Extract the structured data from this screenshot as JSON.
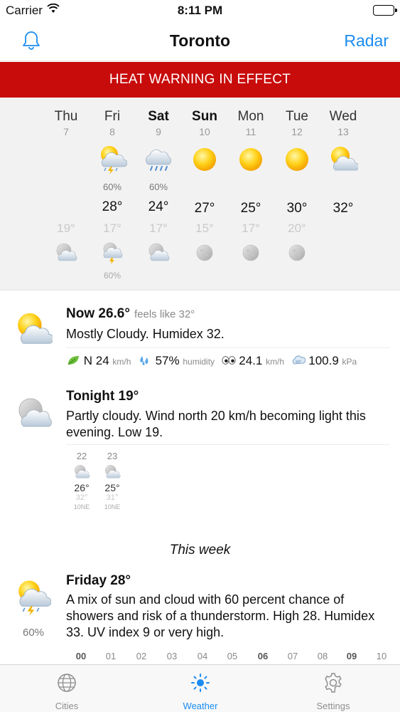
{
  "status_bar": {
    "carrier": "Carrier",
    "time": "8:11 PM"
  },
  "nav": {
    "title": "Toronto",
    "right_label": "Radar",
    "left_icon": "bell-icon"
  },
  "alert": {
    "text": "HEAT WARNING IN EFFECT",
    "color": "#c80b0b"
  },
  "forecast": [
    {
      "day": "Thu",
      "date": "7",
      "bold": false,
      "icon": "",
      "pop": "",
      "high": "",
      "low": "19°",
      "night_icon": "night-partly-cloudy-icon",
      "night_pop": ""
    },
    {
      "day": "Fri",
      "date": "8",
      "bold": false,
      "icon": "sun-cloud-thunder-icon",
      "pop": "60%",
      "high": "28°",
      "low": "17°",
      "night_icon": "night-thunder-icon",
      "night_pop": "60%"
    },
    {
      "day": "Sat",
      "date": "9",
      "bold": true,
      "icon": "cloud-rain-icon",
      "pop": "60%",
      "high": "24°",
      "low": "17°",
      "night_icon": "night-partly-cloudy-icon",
      "night_pop": ""
    },
    {
      "day": "Sun",
      "date": "10",
      "bold": true,
      "icon": "sun-icon",
      "pop": "",
      "high": "27°",
      "low": "15°",
      "night_icon": "moon-icon",
      "night_pop": ""
    },
    {
      "day": "Mon",
      "date": "11",
      "bold": false,
      "icon": "sun-icon",
      "pop": "",
      "high": "25°",
      "low": "17°",
      "night_icon": "moon-icon",
      "night_pop": ""
    },
    {
      "day": "Tue",
      "date": "12",
      "bold": false,
      "icon": "sun-icon",
      "pop": "",
      "high": "30°",
      "low": "20°",
      "night_icon": "moon-icon",
      "night_pop": ""
    },
    {
      "day": "Wed",
      "date": "13",
      "bold": false,
      "icon": "sun-cloud-icon",
      "pop": "",
      "high": "32°",
      "low": "",
      "night_icon": "",
      "night_pop": ""
    }
  ],
  "now": {
    "label": "Now 26.6°",
    "feels": "feels like 32°",
    "summary": "Mostly Cloudy. Humidex 32.",
    "wind": "N 24",
    "wind_unit": "km/h",
    "humidity": "57%",
    "humidity_unit": "humidity",
    "visibility": "24.1",
    "visibility_unit": "km/h",
    "pressure": "100.9",
    "pressure_unit": "kPa"
  },
  "tonight": {
    "label": "Tonight 19°",
    "desc": "Partly cloudy. Wind north 20 km/h becoming light this evening. Low 19.",
    "hours": [
      {
        "hour": "22",
        "temp": "26°",
        "feels": "32°",
        "wind": "10NE"
      },
      {
        "hour": "23",
        "temp": "25°",
        "feels": "31°",
        "wind": "10NE"
      }
    ]
  },
  "week_heading": "This week",
  "friday": {
    "label": "Friday 28°",
    "pop": "60%",
    "desc": "A mix of sun and cloud with 60 percent chance of showers and risk of a thunderstorm. High 28. Humidex 33. UV index 9 or very high.",
    "hours": [
      "00",
      "01",
      "02",
      "03",
      "04",
      "05",
      "06",
      "07",
      "08",
      "09",
      "10"
    ],
    "bold_hours": [
      "00",
      "06",
      "09"
    ]
  },
  "tabs": [
    {
      "label": "Cities",
      "icon": "globe-icon",
      "active": false
    },
    {
      "label": "Weather",
      "icon": "sun-tab-icon",
      "active": true
    },
    {
      "label": "Settings",
      "icon": "gear-icon",
      "active": false
    }
  ],
  "colors": {
    "accent": "#1a8cf0",
    "alert": "#c80b0b"
  }
}
